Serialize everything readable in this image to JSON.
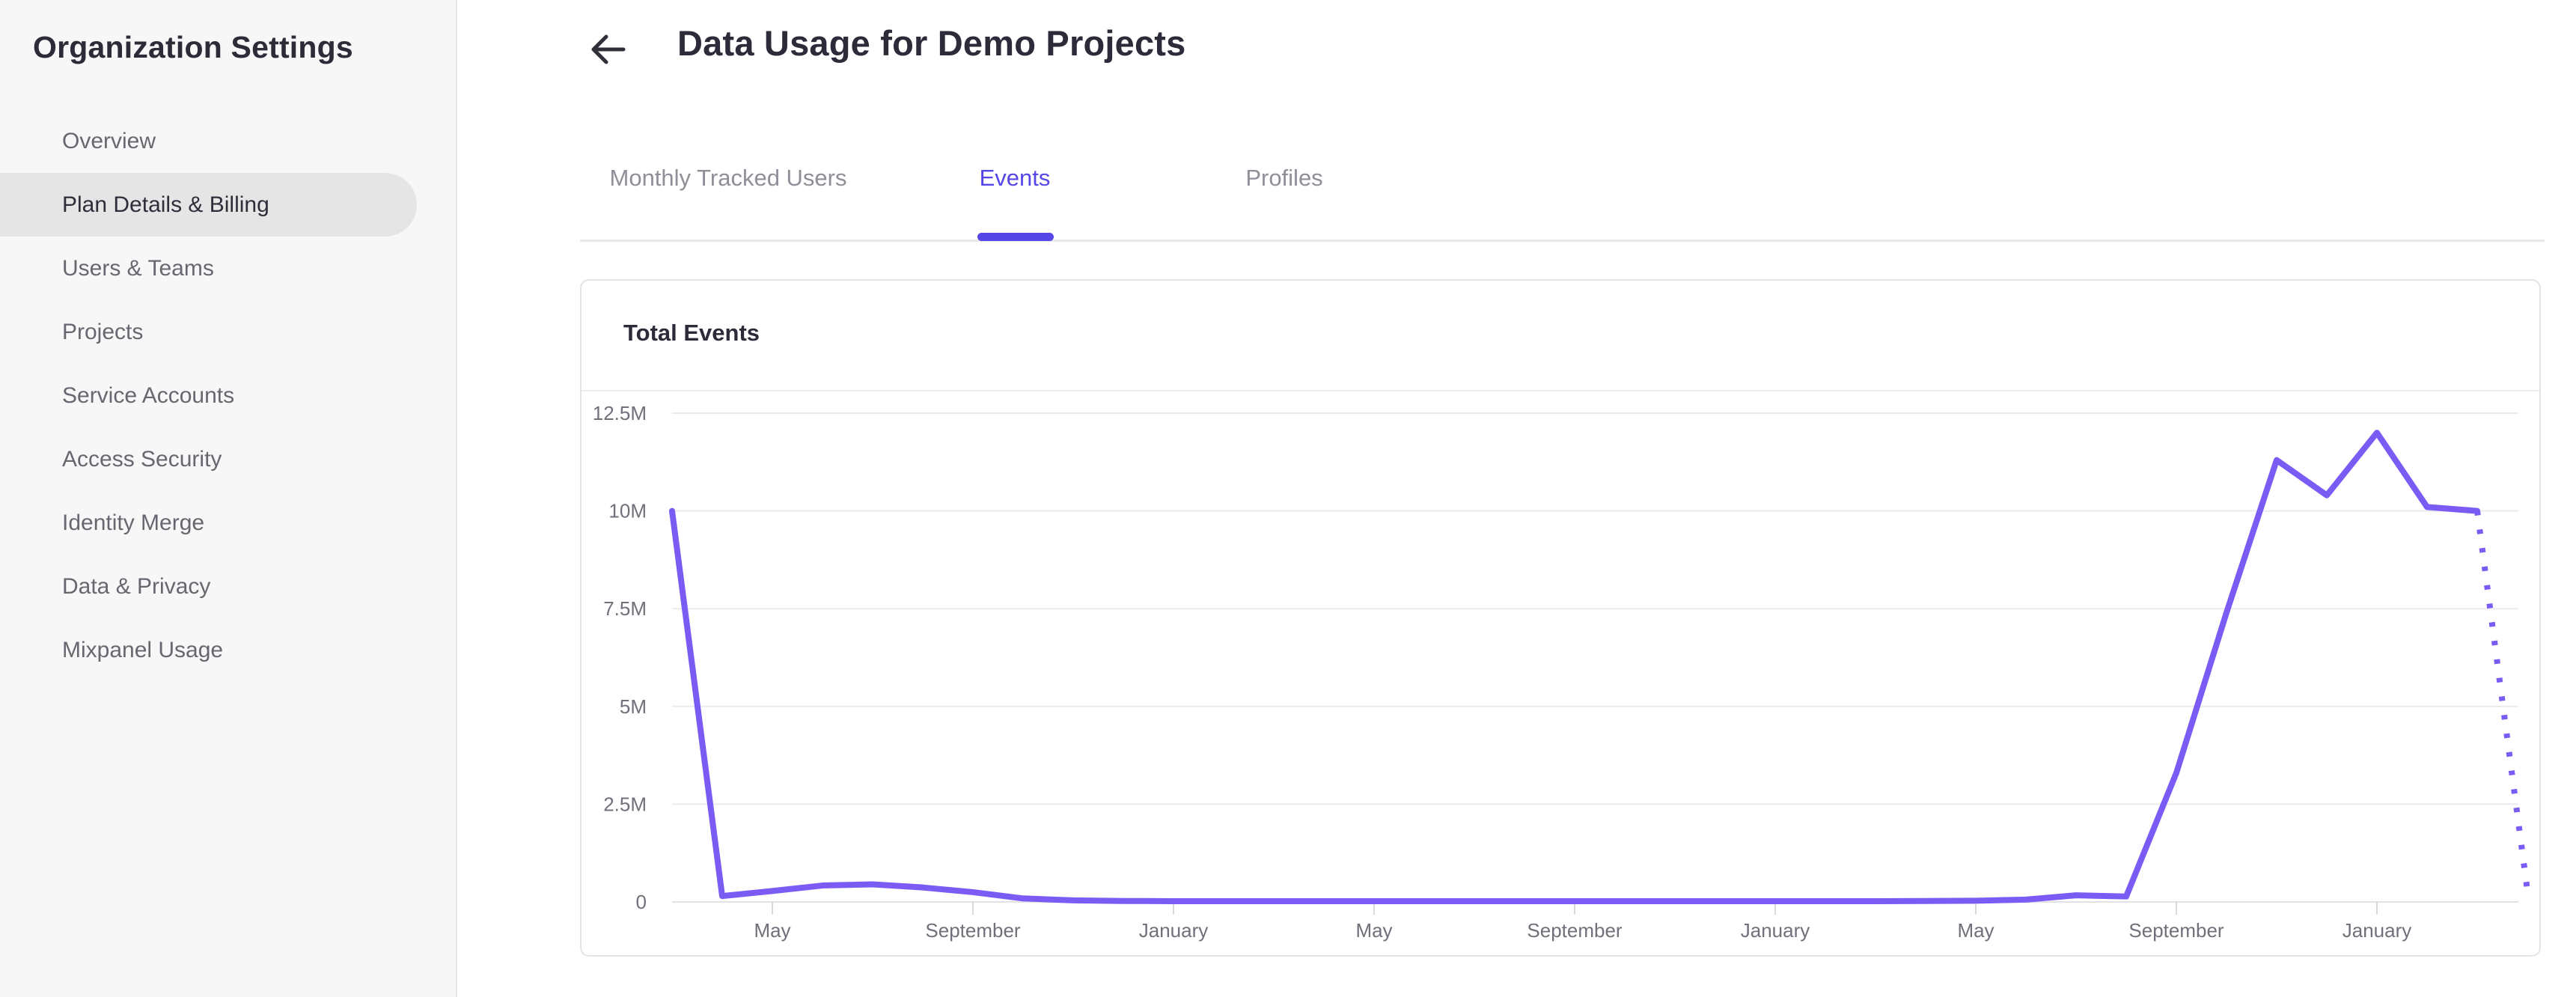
{
  "sidebar": {
    "title": "Organization Settings",
    "items": [
      {
        "label": "Overview",
        "selected": false
      },
      {
        "label": "Plan Details & Billing",
        "selected": true
      },
      {
        "label": "Users & Teams",
        "selected": false
      },
      {
        "label": "Projects",
        "selected": false
      },
      {
        "label": "Service Accounts",
        "selected": false
      },
      {
        "label": "Access Security",
        "selected": false
      },
      {
        "label": "Identity Merge",
        "selected": false
      },
      {
        "label": "Data & Privacy",
        "selected": false
      },
      {
        "label": "Mixpanel Usage",
        "selected": false
      }
    ]
  },
  "header": {
    "title": "Data Usage for Demo Projects"
  },
  "tabs": [
    {
      "label": "Monthly Tracked Users",
      "active": false
    },
    {
      "label": "Events",
      "active": true
    },
    {
      "label": "Profiles",
      "active": false
    }
  ],
  "card": {
    "title": "Total Events"
  },
  "colors": {
    "accent": "#5646e8",
    "line": "#7a5cf5",
    "grid": "#ebebed",
    "zero_line": "#e2e2e5",
    "tick": "#d9d9db",
    "axis_text": "#70707a"
  },
  "chart_data": {
    "type": "line",
    "title": "Total Events",
    "ylim": [
      0,
      12500000
    ],
    "y_ticks": [
      "12.5M",
      "10M",
      "7.5M",
      "5M",
      "2.5M",
      "0"
    ],
    "y_tick_values": [
      12500000,
      10000000,
      7500000,
      5000000,
      2500000,
      0
    ],
    "x_tick_labels": [
      "May",
      "September",
      "January",
      "May",
      "September",
      "January",
      "May",
      "September",
      "January"
    ],
    "x_tick_months": [
      2,
      6,
      10,
      14,
      18,
      22,
      26,
      30,
      34
    ],
    "grid": true,
    "legend": false,
    "series": [
      {
        "name": "Total Events",
        "points": [
          [
            0,
            10000000
          ],
          [
            1,
            150000
          ],
          [
            2,
            280000
          ],
          [
            3,
            420000
          ],
          [
            4,
            450000
          ],
          [
            5,
            370000
          ],
          [
            6,
            250000
          ],
          [
            7,
            90000
          ],
          [
            8,
            40000
          ],
          [
            9,
            25000
          ],
          [
            10,
            20000
          ],
          [
            11,
            20000
          ],
          [
            12,
            20000
          ],
          [
            13,
            20000
          ],
          [
            14,
            20000
          ],
          [
            15,
            20000
          ],
          [
            16,
            20000
          ],
          [
            17,
            20000
          ],
          [
            18,
            20000
          ],
          [
            19,
            20000
          ],
          [
            20,
            20000
          ],
          [
            21,
            20000
          ],
          [
            22,
            20000
          ],
          [
            23,
            20000
          ],
          [
            24,
            20000
          ],
          [
            25,
            25000
          ],
          [
            26,
            30000
          ],
          [
            27,
            60000
          ],
          [
            28,
            170000
          ],
          [
            29,
            140000
          ],
          [
            30,
            3300000
          ],
          [
            31,
            7400000
          ],
          [
            32,
            11300000
          ],
          [
            33,
            10400000
          ],
          [
            34,
            12000000
          ],
          [
            35,
            10100000
          ],
          [
            36,
            10000000
          ]
        ],
        "projected_point": [
          37,
          300000
        ],
        "projected_style": "dotted"
      }
    ]
  }
}
